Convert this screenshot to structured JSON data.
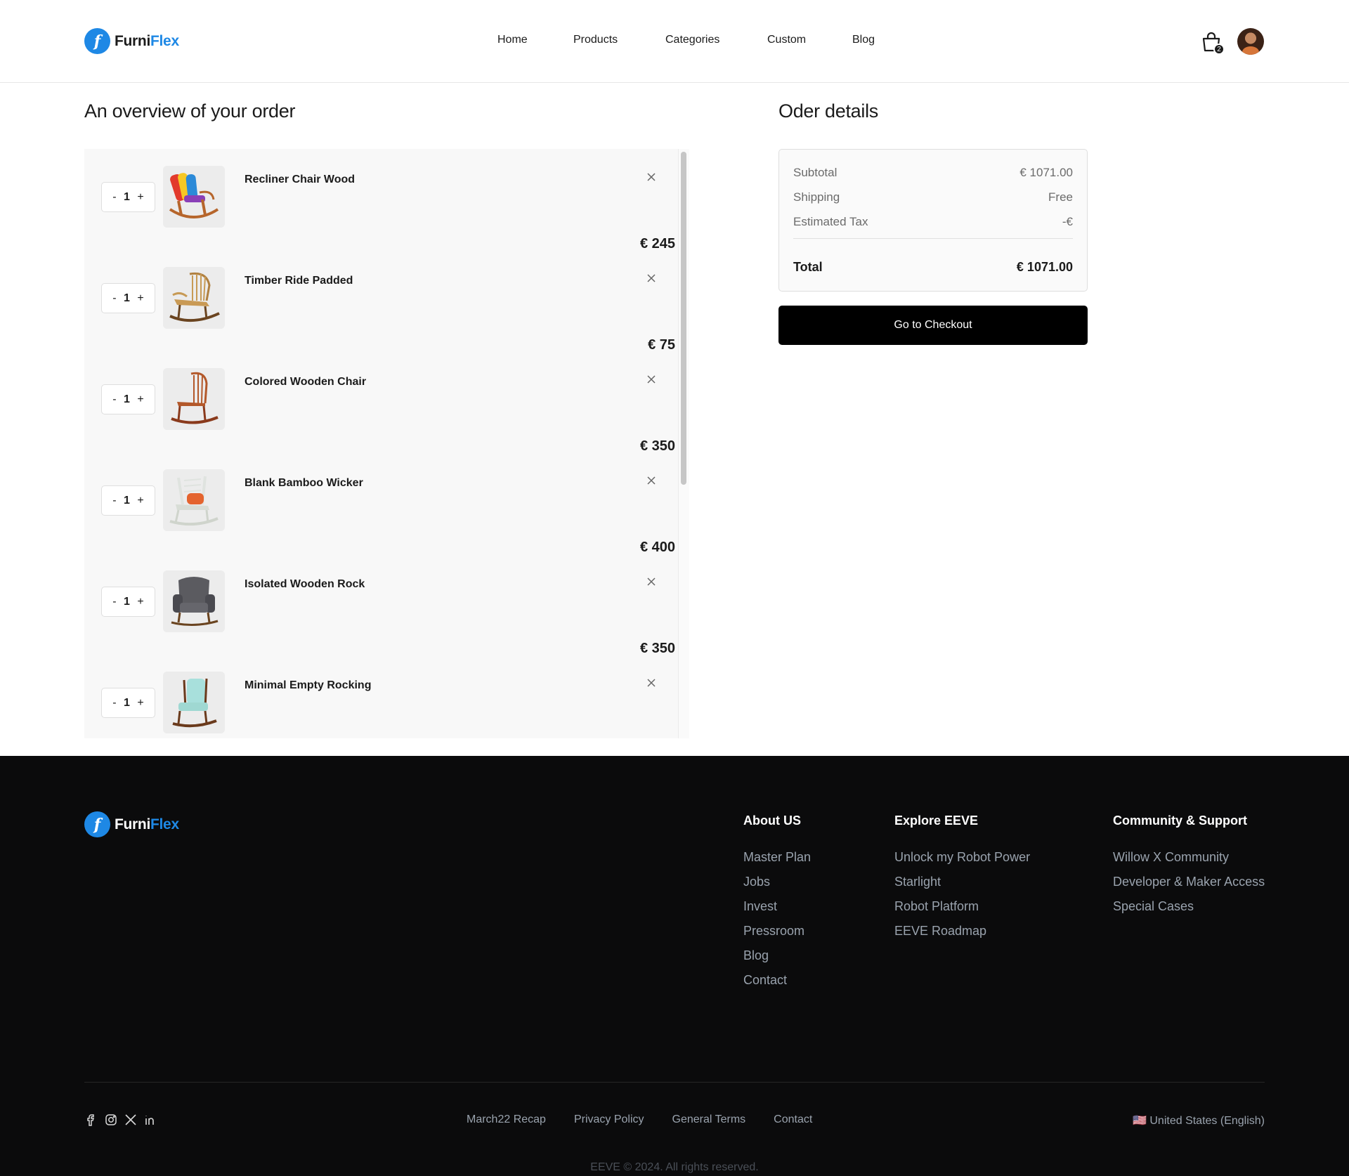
{
  "brand": {
    "name_part1": "Furni",
    "name_part2": "Flex",
    "logo_letter": "f"
  },
  "nav": {
    "items": [
      "Home",
      "Products",
      "Categories",
      "Custom",
      "Blog"
    ]
  },
  "header": {
    "cart_count": "2"
  },
  "order": {
    "title": "An overview of your order",
    "items": [
      {
        "name": "Recliner Chair Wood",
        "qty": "1",
        "price": "€ 245",
        "minus": "-",
        "plus": "+"
      },
      {
        "name": "Timber Ride Padded",
        "qty": "1",
        "price": "€ 75",
        "minus": "-",
        "plus": "+"
      },
      {
        "name": "Colored Wooden Chair",
        "qty": "1",
        "price": "€ 350",
        "minus": "-",
        "plus": "+"
      },
      {
        "name": "Blank Bamboo Wicker",
        "qty": "1",
        "price": "€ 400",
        "minus": "-",
        "plus": "+"
      },
      {
        "name": "Isolated Wooden Rock",
        "qty": "1",
        "price": "€ 350",
        "minus": "-",
        "plus": "+"
      },
      {
        "name": "Minimal Empty Rocking",
        "qty": "1",
        "price": "",
        "minus": "-",
        "plus": "+"
      }
    ]
  },
  "details": {
    "title": "Oder details",
    "subtotal_label": "Subtotal",
    "subtotal_value": "€ 1071.00",
    "shipping_label": "Shipping",
    "shipping_value": "Free",
    "tax_label": "Estimated Tax",
    "tax_value": "-€",
    "total_label": "Total",
    "total_value": "€ 1071.00",
    "checkout_label": "Go to Checkout"
  },
  "footer": {
    "columns": [
      {
        "title": "About US",
        "links": [
          "Master Plan",
          "Jobs",
          "Invest",
          "Pressroom",
          "Blog",
          "Contact"
        ]
      },
      {
        "title": "Explore EEVE",
        "links": [
          "Unlock my Robot Power",
          "Starlight",
          "Robot Platform",
          "EEVE Roadmap"
        ]
      },
      {
        "title": "Community & Support",
        "links": [
          "Willow X Community",
          "Developer & Maker Access",
          "Special Cases"
        ]
      }
    ],
    "bottom_links": [
      "March22 Recap",
      "Privacy Policy",
      "General Terms",
      "Contact"
    ],
    "language": "🇺🇸 United States (English)",
    "copyright": "EEVE © 2024. All rights reserved.",
    "social_icons": [
      "facebook-icon",
      "instagram-icon",
      "x-icon",
      "linkedin-icon"
    ]
  },
  "colors": {
    "accent": "#1e88e5",
    "footer_bg": "#0b0b0c",
    "button_bg": "#000000"
  }
}
